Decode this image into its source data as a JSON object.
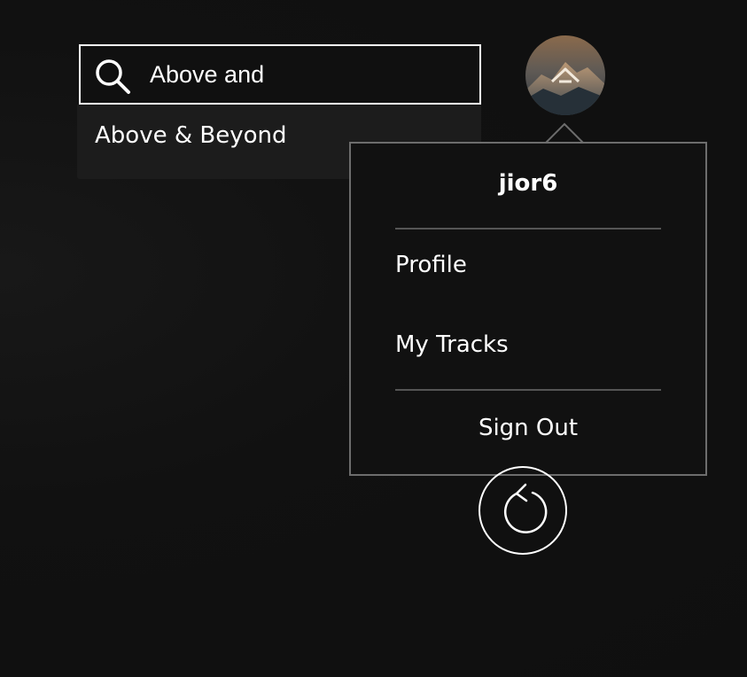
{
  "search": {
    "value": "Above and",
    "suggestions": [
      {
        "label": "Above & Beyond"
      }
    ]
  },
  "user_menu": {
    "username": "jior6",
    "items": [
      {
        "label": "Profile"
      },
      {
        "label": "My Tracks"
      }
    ],
    "sign_out_label": "Sign Out"
  },
  "icons": {
    "search": "magnifier-icon",
    "avatar": "mountain-logo-avatar",
    "refresh": "refresh-icon"
  },
  "colors": {
    "background": "#101010",
    "suggestion_panel": "#1c1c1c",
    "menu_border": "#6d6d6d",
    "divider": "#555555",
    "text": "#ffffff"
  }
}
